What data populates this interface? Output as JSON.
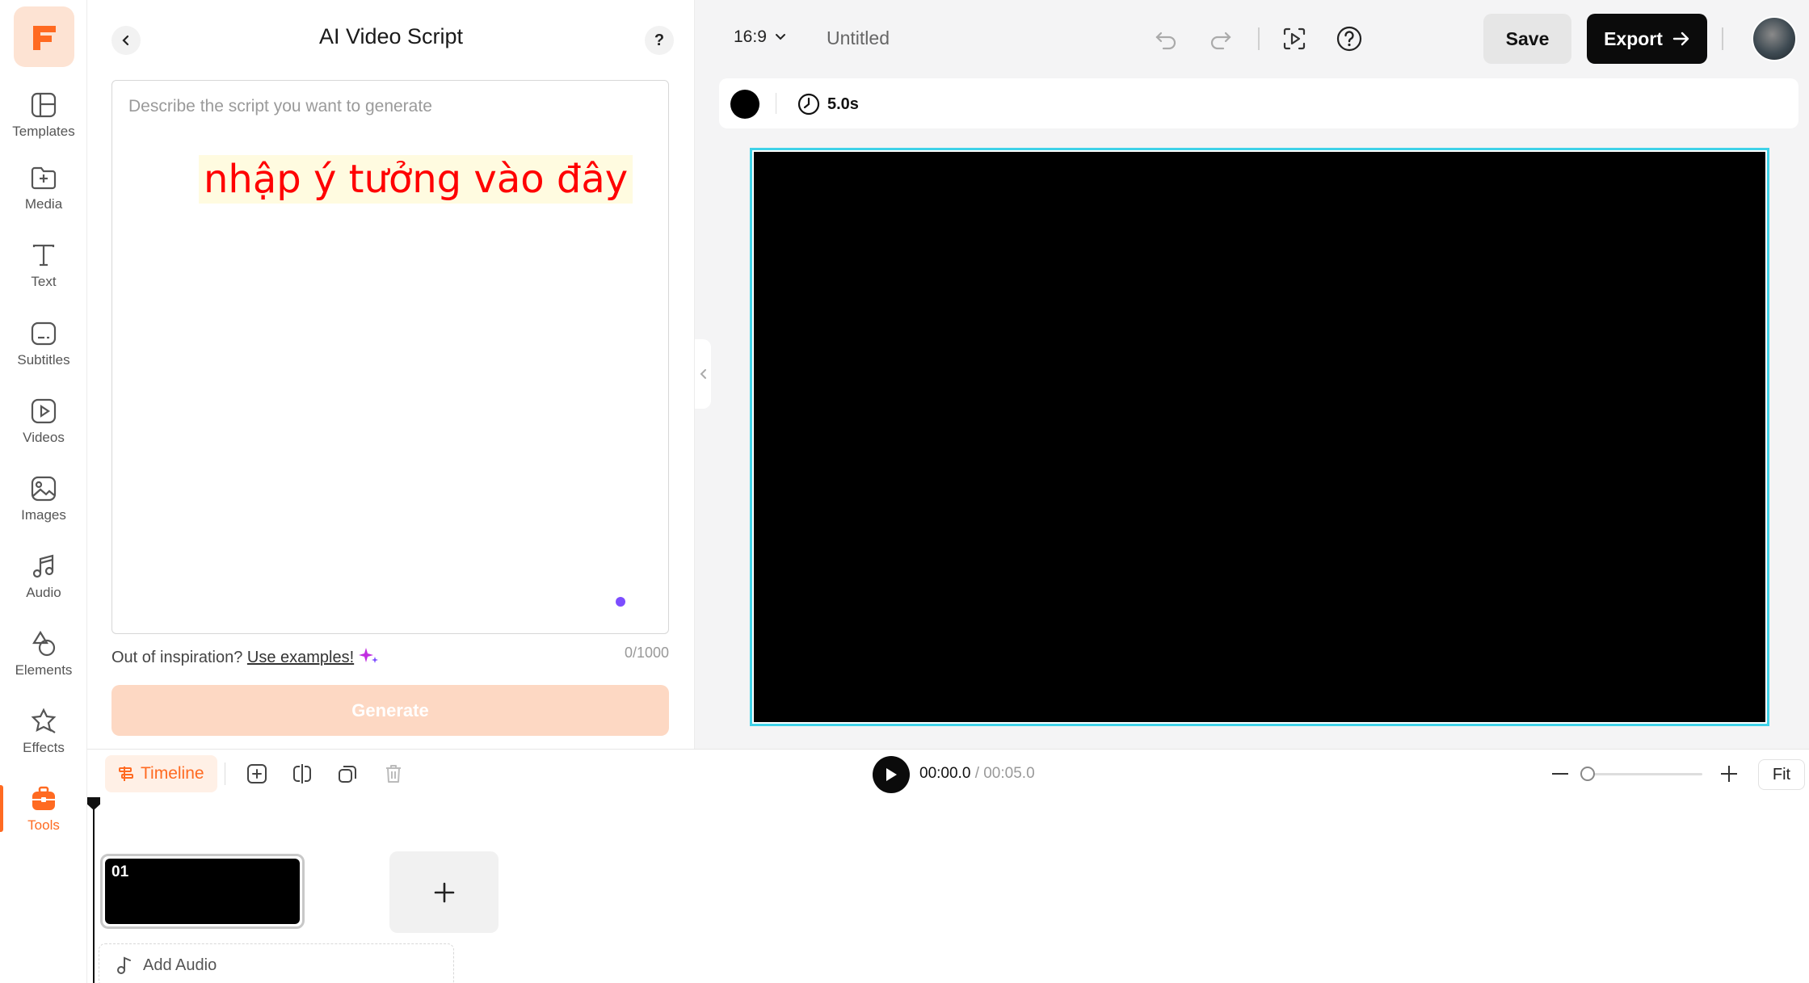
{
  "rail": {
    "items": [
      {
        "label": "Templates",
        "icon": "templates-icon"
      },
      {
        "label": "Media",
        "icon": "media-icon"
      },
      {
        "label": "Text",
        "icon": "text-icon"
      },
      {
        "label": "Subtitles",
        "icon": "subtitles-icon"
      },
      {
        "label": "Videos",
        "icon": "videos-icon"
      },
      {
        "label": "Images",
        "icon": "images-icon"
      },
      {
        "label": "Audio",
        "icon": "audio-icon"
      },
      {
        "label": "Elements",
        "icon": "elements-icon"
      },
      {
        "label": "Effects",
        "icon": "effects-icon"
      },
      {
        "label": "Tools",
        "icon": "tools-icon",
        "active": true
      }
    ],
    "accent": "#ff6a21"
  },
  "panel": {
    "title": "AI Video Script",
    "help": "?",
    "placeholder": "Describe the script you want to generate",
    "overlay_text": "nhập ý tưởng vào đây",
    "inspire_prefix": "Out of inspiration?",
    "inspire_link": "Use examples!",
    "char_count": "0/1000",
    "generate_label": "Generate"
  },
  "topbar": {
    "ratio": "16:9",
    "doc_title": "Untitled",
    "save_label": "Save",
    "export_label": "Export"
  },
  "props": {
    "duration": "5.0s",
    "bg_color": "#000000"
  },
  "timeline": {
    "tab_label": "Timeline",
    "current_time": "00:00.0",
    "total_time": "/ 00:05.0",
    "fit_label": "Fit",
    "clip_number": "01",
    "add_audio_label": "Add Audio"
  },
  "colors": {
    "canvas_border": "#3fd2e8",
    "generate_disabled": "#fdd8c3"
  }
}
